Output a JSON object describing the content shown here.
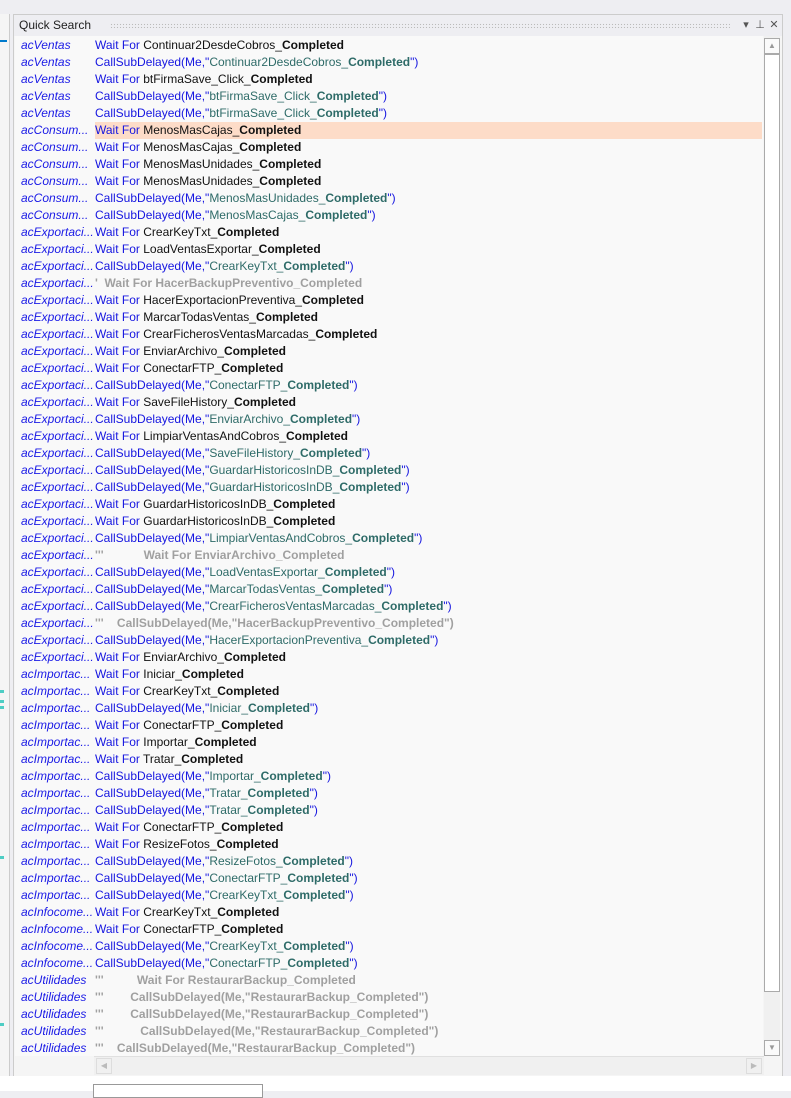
{
  "panel": {
    "title": "Quick Search",
    "dropdown_icon": "chevron-down-icon",
    "pin_icon": "pin-icon",
    "close_icon": "close-icon"
  },
  "selected_row": 5,
  "colors": {
    "keyword": "#1515e0",
    "module": "#1a1ae6",
    "string": "#2e6b68",
    "comment": "#a0a0a0",
    "selection": "#fddcc8"
  },
  "labels": {
    "wait": "Wait For ",
    "call": "CallSubDelayed(Me,\"",
    "call_end": "\")",
    "completed": "Completed"
  },
  "rows": [
    {
      "module": "acVentas",
      "kind": "wait",
      "name": "Continuar2DesdeCobros_"
    },
    {
      "module": "acVentas",
      "kind": "call",
      "name": "Continuar2DesdeCobros_"
    },
    {
      "module": "acVentas",
      "kind": "wait",
      "name": "btFirmaSave_Click_"
    },
    {
      "module": "acVentas",
      "kind": "call",
      "name": "btFirmaSave_Click_"
    },
    {
      "module": "acVentas",
      "kind": "call",
      "name": "btFirmaSave_Click_"
    },
    {
      "module": "acConsum...",
      "kind": "wait",
      "name": "MenosMasCajas_"
    },
    {
      "module": "acConsum...",
      "kind": "wait",
      "name": "MenosMasCajas_"
    },
    {
      "module": "acConsum...",
      "kind": "wait",
      "name": "MenosMasUnidades_"
    },
    {
      "module": "acConsum...",
      "kind": "wait",
      "name": "MenosMasUnidades_"
    },
    {
      "module": "acConsum...",
      "kind": "call",
      "name": "MenosMasUnidades_"
    },
    {
      "module": "acConsum...",
      "kind": "call",
      "name": "MenosMasCajas_"
    },
    {
      "module": "acExportaci...",
      "kind": "wait",
      "name": "CrearKeyTxt_"
    },
    {
      "module": "acExportaci...",
      "kind": "wait",
      "name": "LoadVentasExportar_"
    },
    {
      "module": "acExportaci...",
      "kind": "call",
      "name": "CrearKeyTxt_"
    },
    {
      "module": "acExportaci...",
      "kind": "comment",
      "text": "'  Wait For HacerBackupPreventivo_Completed"
    },
    {
      "module": "acExportaci...",
      "kind": "wait",
      "name": "HacerExportacionPreventiva_"
    },
    {
      "module": "acExportaci...",
      "kind": "wait",
      "name": "MarcarTodasVentas_"
    },
    {
      "module": "acExportaci...",
      "kind": "wait",
      "name": "CrearFicherosVentasMarcadas_"
    },
    {
      "module": "acExportaci...",
      "kind": "wait",
      "name": "EnviarArchivo_"
    },
    {
      "module": "acExportaci...",
      "kind": "wait",
      "name": "ConectarFTP_"
    },
    {
      "module": "acExportaci...",
      "kind": "call",
      "name": "ConectarFTP_"
    },
    {
      "module": "acExportaci...",
      "kind": "wait",
      "name": "SaveFileHistory_"
    },
    {
      "module": "acExportaci...",
      "kind": "call",
      "name": "EnviarArchivo_"
    },
    {
      "module": "acExportaci...",
      "kind": "wait",
      "name": "LimpiarVentasAndCobros_"
    },
    {
      "module": "acExportaci...",
      "kind": "call",
      "name": "SaveFileHistory_"
    },
    {
      "module": "acExportaci...",
      "kind": "call",
      "name": "GuardarHistoricosInDB_"
    },
    {
      "module": "acExportaci...",
      "kind": "call",
      "name": "GuardarHistoricosInDB_"
    },
    {
      "module": "acExportaci...",
      "kind": "wait",
      "name": "GuardarHistoricosInDB_"
    },
    {
      "module": "acExportaci...",
      "kind": "wait",
      "name": "GuardarHistoricosInDB_"
    },
    {
      "module": "acExportaci...",
      "kind": "call",
      "name": "LimpiarVentasAndCobros_"
    },
    {
      "module": "acExportaci...",
      "kind": "comment",
      "text": "'''            Wait For EnviarArchivo_Completed"
    },
    {
      "module": "acExportaci...",
      "kind": "call",
      "name": "LoadVentasExportar_"
    },
    {
      "module": "acExportaci...",
      "kind": "call",
      "name": "MarcarTodasVentas_"
    },
    {
      "module": "acExportaci...",
      "kind": "call",
      "name": "CrearFicherosVentasMarcadas_"
    },
    {
      "module": "acExportaci...",
      "kind": "comment",
      "text": "'''    CallSubDelayed(Me,\"HacerBackupPreventivo_Completed\")"
    },
    {
      "module": "acExportaci...",
      "kind": "call",
      "name": "HacerExportacionPreventiva_"
    },
    {
      "module": "acExportaci...",
      "kind": "wait",
      "name": "EnviarArchivo_"
    },
    {
      "module": "acImportac...",
      "kind": "wait",
      "name": "Iniciar_"
    },
    {
      "module": "acImportac...",
      "kind": "wait",
      "name": "CrearKeyTxt_"
    },
    {
      "module": "acImportac...",
      "kind": "call",
      "name": "Iniciar_"
    },
    {
      "module": "acImportac...",
      "kind": "wait",
      "name": "ConectarFTP_"
    },
    {
      "module": "acImportac...",
      "kind": "wait",
      "name": "Importar_"
    },
    {
      "module": "acImportac...",
      "kind": "wait",
      "name": "Tratar_"
    },
    {
      "module": "acImportac...",
      "kind": "call",
      "name": "Importar_"
    },
    {
      "module": "acImportac...",
      "kind": "call",
      "name": "Tratar_"
    },
    {
      "module": "acImportac...",
      "kind": "call",
      "name": "Tratar_"
    },
    {
      "module": "acImportac...",
      "kind": "wait",
      "name": "ConectarFTP_"
    },
    {
      "module": "acImportac...",
      "kind": "wait",
      "name": "ResizeFotos_"
    },
    {
      "module": "acImportac...",
      "kind": "call",
      "name": "ResizeFotos_"
    },
    {
      "module": "acImportac...",
      "kind": "call",
      "name": "ConectarFTP_"
    },
    {
      "module": "acImportac...",
      "kind": "call",
      "name": "CrearKeyTxt_"
    },
    {
      "module": "acInfocome...",
      "kind": "wait",
      "name": "CrearKeyTxt_"
    },
    {
      "module": "acInfocome...",
      "kind": "wait",
      "name": "ConectarFTP_"
    },
    {
      "module": "acInfocome...",
      "kind": "call",
      "name": "CrearKeyTxt_"
    },
    {
      "module": "acInfocome...",
      "kind": "call",
      "name": "ConectarFTP_"
    },
    {
      "module": "acUtilidades",
      "kind": "comment",
      "text": "'''          Wait For RestaurarBackup_Completed"
    },
    {
      "module": "acUtilidades",
      "kind": "comment",
      "text": "'''        CallSubDelayed(Me,\"RestaurarBackup_Completed\")"
    },
    {
      "module": "acUtilidades",
      "kind": "comment",
      "text": "'''        CallSubDelayed(Me,\"RestaurarBackup_Completed\")"
    },
    {
      "module": "acUtilidades",
      "kind": "comment",
      "text": "'''           CallSubDelayed(Me,\"RestaurarBackup_Completed\")"
    },
    {
      "module": "acUtilidades",
      "kind": "comment",
      "text": "'''    CallSubDelayed(Me,\"RestaurarBackup_Completed\")"
    }
  ]
}
